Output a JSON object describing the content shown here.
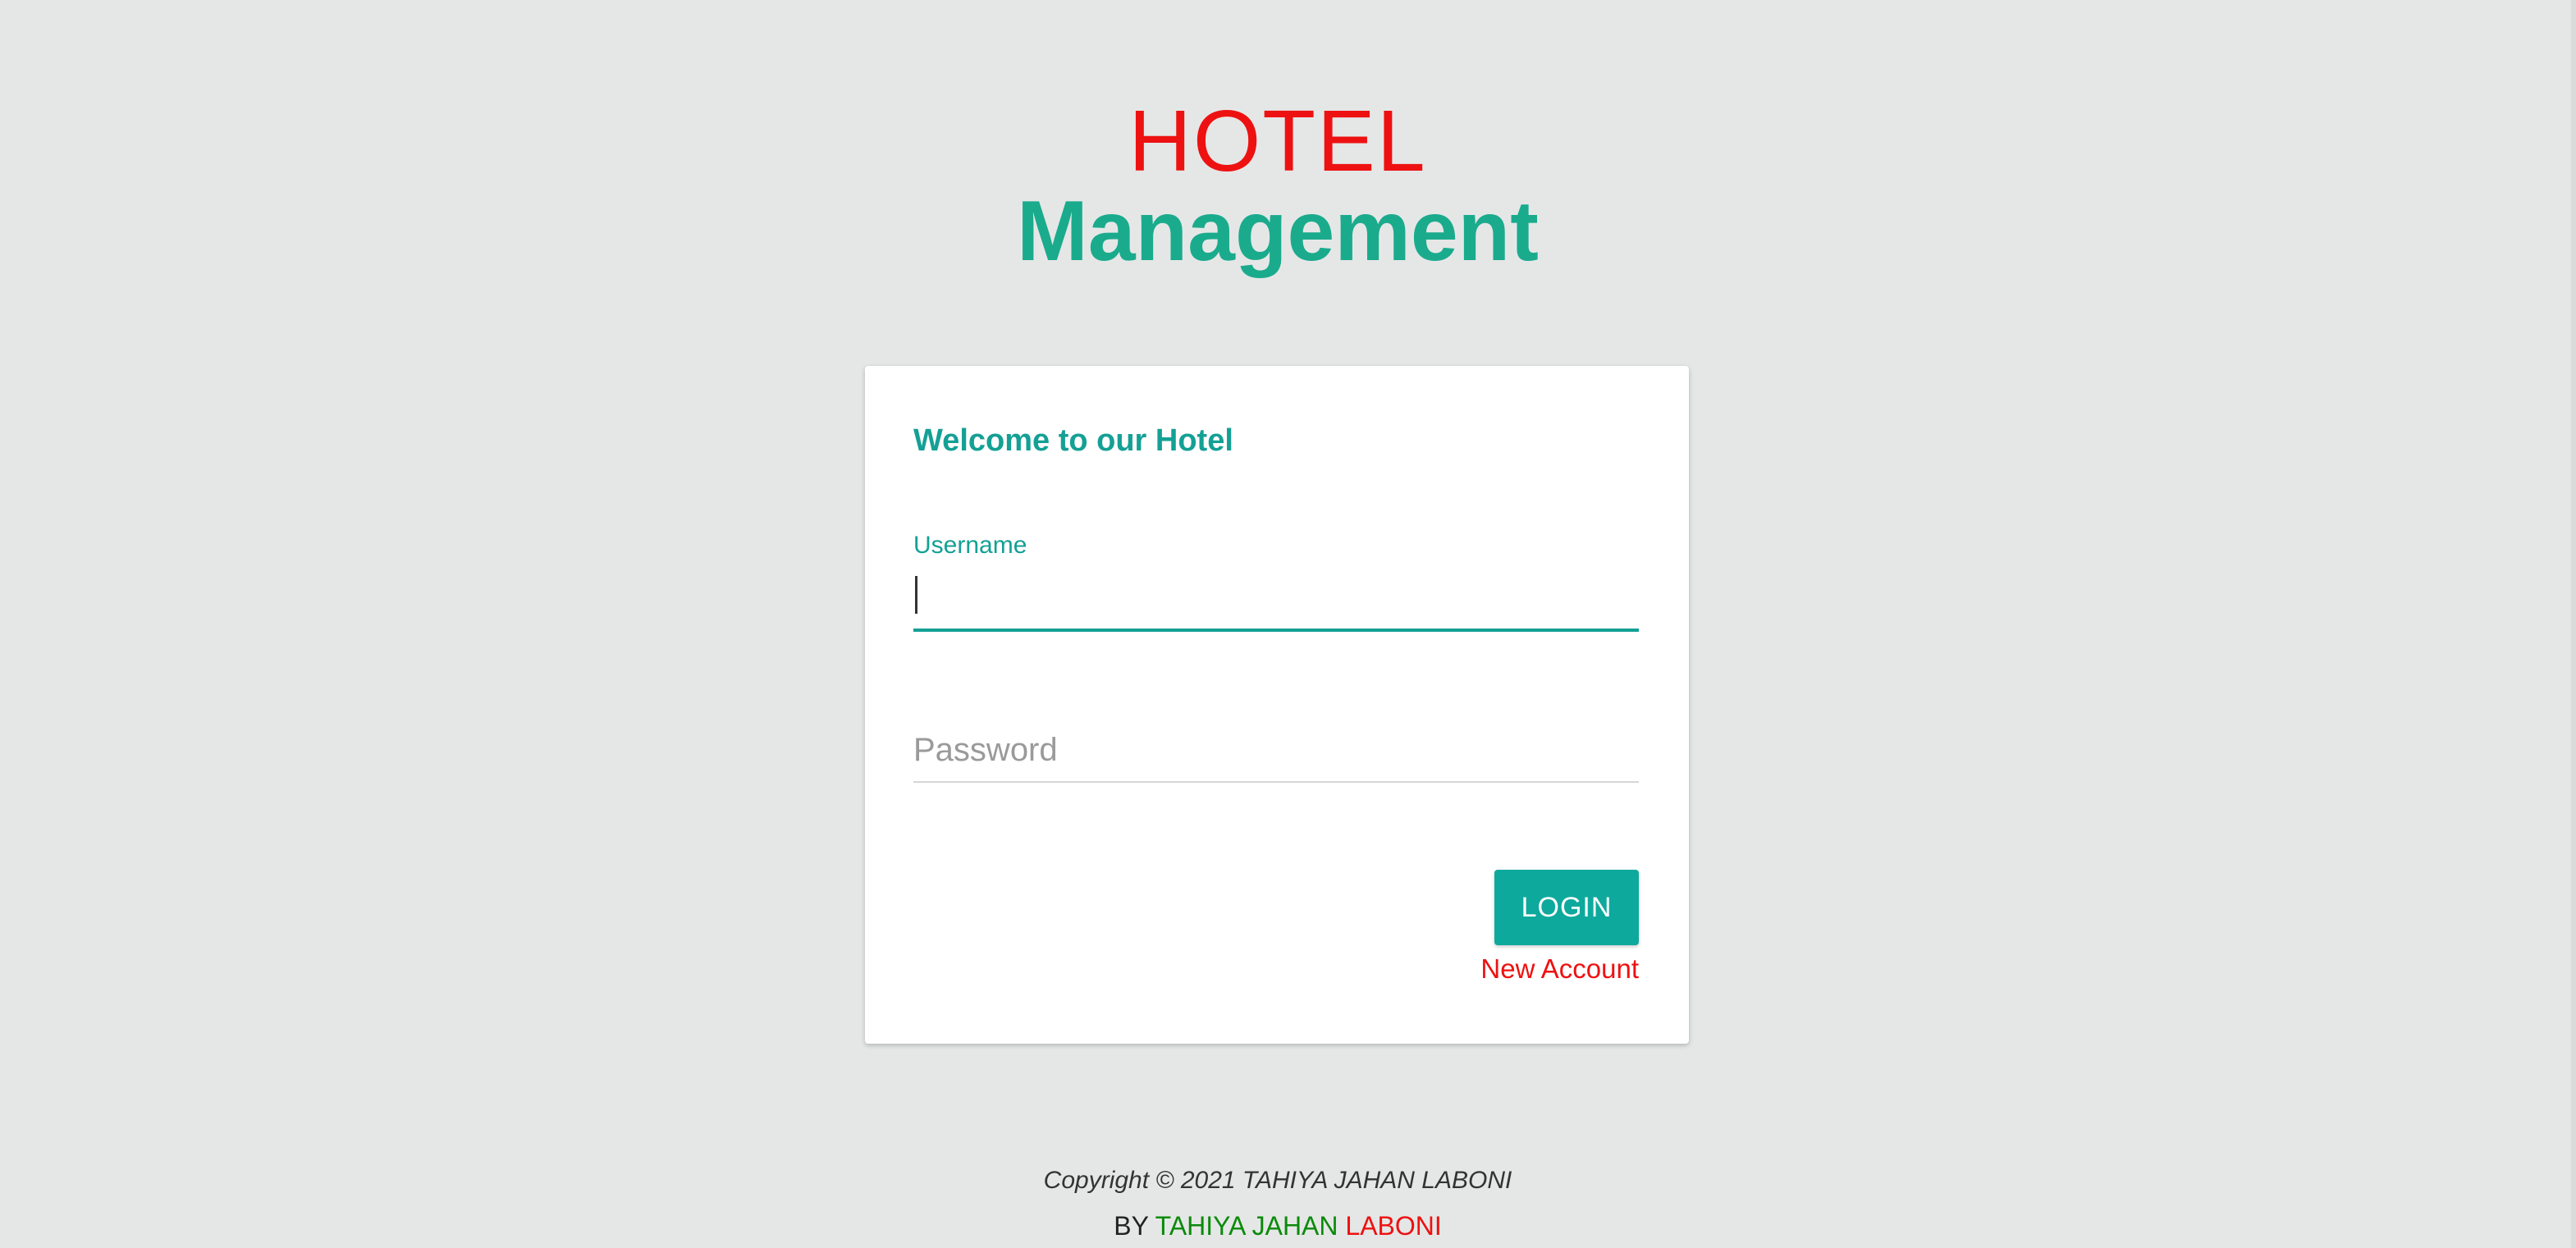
{
  "header": {
    "line1": "HOTEL",
    "line2": "Management"
  },
  "login_card": {
    "title": "Welcome to our Hotel",
    "username_label": "Username",
    "username_value": "",
    "password_placeholder": "Password",
    "password_value": "",
    "login_label": "LOGIN",
    "new_account_label": "New Account"
  },
  "footer": {
    "copyright": "Copyright © 2021 TAHIYA JAHAN LABONI",
    "by_prefix": "BY",
    "by_name_part1": "TAHIYA JAHAN",
    "by_name_part2": "LABONI"
  },
  "colors": {
    "background": "#e5e7e6",
    "accent": "#14a095",
    "brand_red": "#ee1111",
    "brand_green": "#1aab8d"
  }
}
